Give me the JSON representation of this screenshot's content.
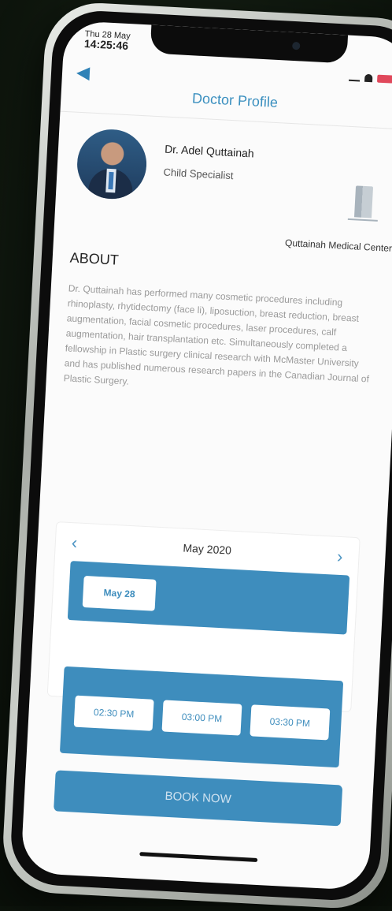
{
  "status": {
    "date": "Thu 28 May",
    "time": "14:25:46"
  },
  "header": {
    "title": "Doctor Profile",
    "back_icon": "back-arrow-icon"
  },
  "doctor": {
    "name": "Dr. Adel Quttainah",
    "specialty": "Child Specialist",
    "center": "Quttainah Medical Center"
  },
  "about": {
    "title": "ABOUT",
    "text": "Dr. Quttainah has performed many cosmetic procedures including rhinoplasty, rhytidectomy (face li), liposuction, breast reduction, breast augmentation, facial cosmetic procedures, laser procedures, calf augmentation, hair transplantation etc. Simultaneously completed a fellowship in Plastic surgery clinical research with McMaster University and has published numerous research papers in the Canadian Journal of Plastic Surgery."
  },
  "calendar": {
    "month": "May 2020",
    "prev": "‹",
    "next": "›",
    "selected_date": "May 28"
  },
  "slots": [
    "02:30 PM",
    "03:00 PM",
    "03:30 PM"
  ],
  "book_label": "BOOK NOW",
  "colors": {
    "accent": "#3e8dbd",
    "title": "#3a8fbf"
  }
}
